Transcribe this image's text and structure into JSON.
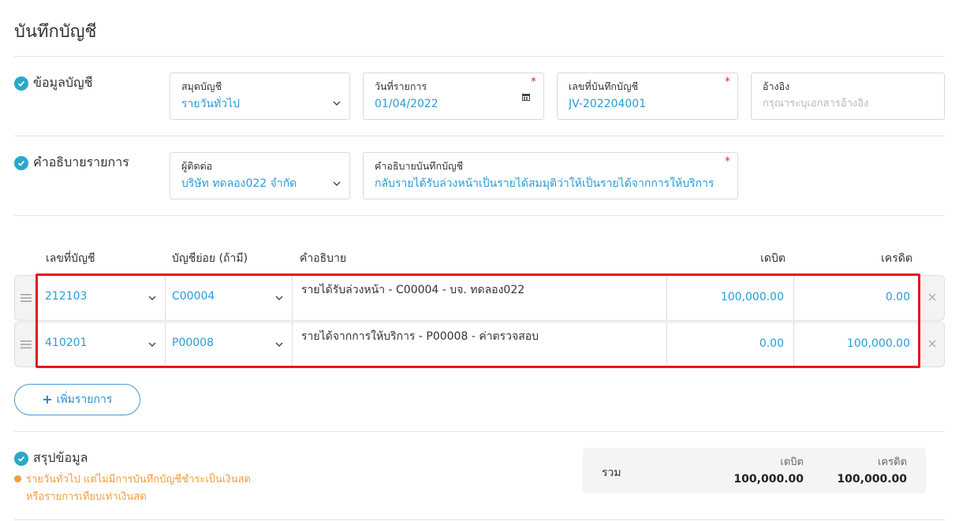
{
  "page": {
    "title": "บันทึกบัญชี"
  },
  "sections": {
    "account_info": "ข้อมูลบัญชี",
    "description": "คำอธิบายรายการ",
    "summary": "สรุปข้อมูล"
  },
  "fields": {
    "journal_book": {
      "label": "สมุดบัญชี",
      "value": "รายวันทั่วไป"
    },
    "transaction_date": {
      "label": "วันที่รายการ",
      "value": "01/04/2022"
    },
    "journal_no": {
      "label": "เลขที่บันทึกบัญชี",
      "value": "JV-202204001"
    },
    "reference": {
      "label": "อ้างอิง",
      "placeholder": "กรุณาระบุเอกสารอ้างอิง"
    },
    "contact": {
      "label": "ผู้ติดต่อ",
      "value": "บริษัท ทดลอง022 จำกัด"
    },
    "journal_desc": {
      "label": "คำอธิบายบันทึกบัญชี",
      "value": "กลับรายได้รับล่วงหน้าเป็นรายได้สมมุติว่าให้เป็นรายได้จากการให้บริการ"
    }
  },
  "table": {
    "headers": [
      "เลขที่บัญชี",
      "บัญชีย่อย (ถ้ามี)",
      "คำอธิบาย",
      "เดบิต",
      "เครดิต"
    ],
    "rows": [
      {
        "account": "212103",
        "sub_account": "C00004",
        "description": "รายได้รับล่วงหน้า - C00004 - บจ.  ทดลอง022",
        "debit": "100,000.00",
        "credit": "0.00"
      },
      {
        "account": "410201",
        "sub_account": "P00008",
        "description": "รายได้จากการให้บริการ - P00008 - ค่าตรวจสอบ",
        "debit": "0.00",
        "credit": "100,000.00"
      }
    ]
  },
  "add_item_label": "เพิ่มรายการ",
  "summary": {
    "note_line1": "รายวันทั่วไป แต่ไม่มีการบันทึกบัญชีชำระเป็นเงินสด",
    "note_line2": "หรือรายการเทียบเท่าเงินสด",
    "total_label": "รวม",
    "debit_label": "เดบิต",
    "credit_label": "เครดิต",
    "total_debit": "100,000.00",
    "total_credit": "100,000.00"
  },
  "colors": {
    "accent": "#2a9bd8",
    "check": "#29a8c7",
    "required": "#e03131",
    "note": "#f39c3c",
    "highlight": "#e8141d"
  }
}
